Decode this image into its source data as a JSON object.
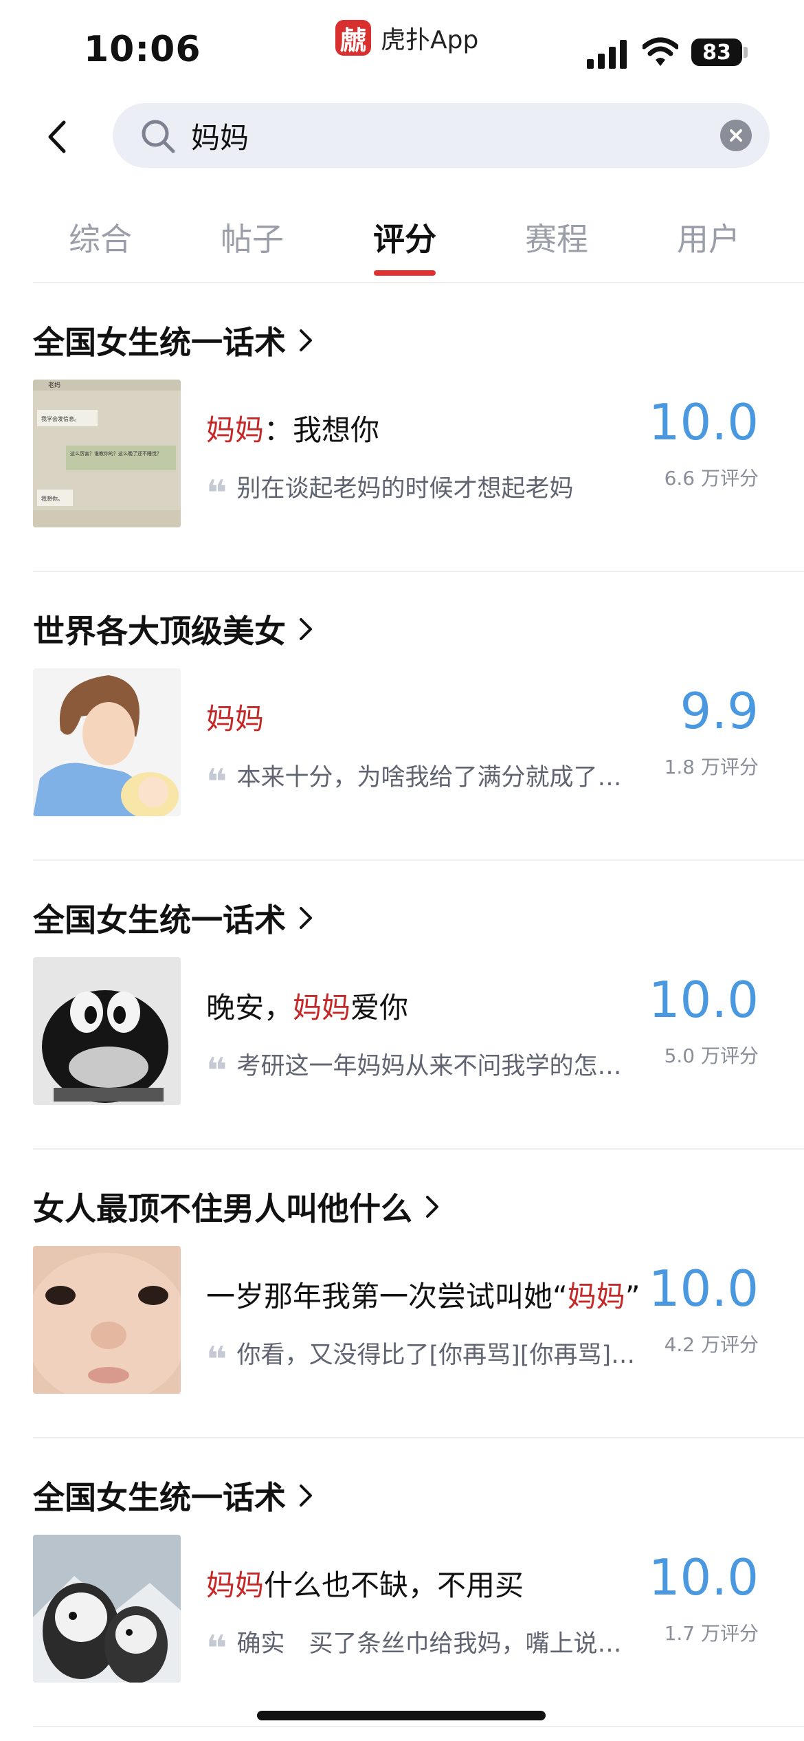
{
  "status_bar": {
    "time": "10:06",
    "app_logo_char": "虤",
    "app_name": "虎扑App",
    "battery": "83"
  },
  "search": {
    "query": "妈妈",
    "placeholder": ""
  },
  "tabs": [
    {
      "label": "综合"
    },
    {
      "label": "帖子"
    },
    {
      "label": "评分",
      "active": true
    },
    {
      "label": "赛程"
    },
    {
      "label": "用户"
    }
  ],
  "results": [
    {
      "group_title": "全国女生统一话术",
      "name_pre": "",
      "name_hl": "妈妈",
      "name_post": "：我想你",
      "comment": "别在谈起老妈的时候才想起老妈",
      "score": "10.0",
      "rating_count": "6.6 万评分",
      "thumb_lines": [
        "老妈",
        "我学会发信息。",
        "这么厉害？谁教你的？这么晚了还不睡觉？",
        "我想你。"
      ]
    },
    {
      "group_title": "世界各大顶级美女",
      "name_pre": "",
      "name_hl": "妈妈",
      "name_post": "",
      "comment": "本来十分，为啥我给了满分就成了…",
      "score": "9.9",
      "rating_count": "1.8 万评分"
    },
    {
      "group_title": "全国女生统一话术",
      "name_pre": "晚安，",
      "name_hl": "妈妈",
      "name_post": "爱你",
      "comment": "考研这一年妈妈从来不问我学的怎…",
      "score": "10.0",
      "rating_count": "5.0 万评分"
    },
    {
      "group_title": "女人最顶不住男人叫他什么",
      "name_pre": "一岁那年我第一次尝试叫她“",
      "name_hl": "妈妈",
      "name_post": "”",
      "comment": "你看，又没得比了[你再骂][你再骂]…",
      "score": "10.0",
      "rating_count": "4.2 万评分"
    },
    {
      "group_title": "全国女生统一话术",
      "name_pre": "",
      "name_hl": "妈妈",
      "name_post": "什么也不缺，不用买",
      "comment": "确实　买了条丝巾给我妈，嘴上说…",
      "score": "10.0",
      "rating_count": "1.7 万评分"
    }
  ],
  "quote_glyph": "❝",
  "colors": {
    "accent_red": "#e03131",
    "highlight_red": "#c62828",
    "score_blue": "#4a98e0",
    "search_bg": "#eceef6"
  },
  "icons": {
    "back": "chevron-left-icon",
    "search": "search-icon",
    "clear": "close-circle-icon",
    "title_arrow": "chevron-right-icon"
  }
}
